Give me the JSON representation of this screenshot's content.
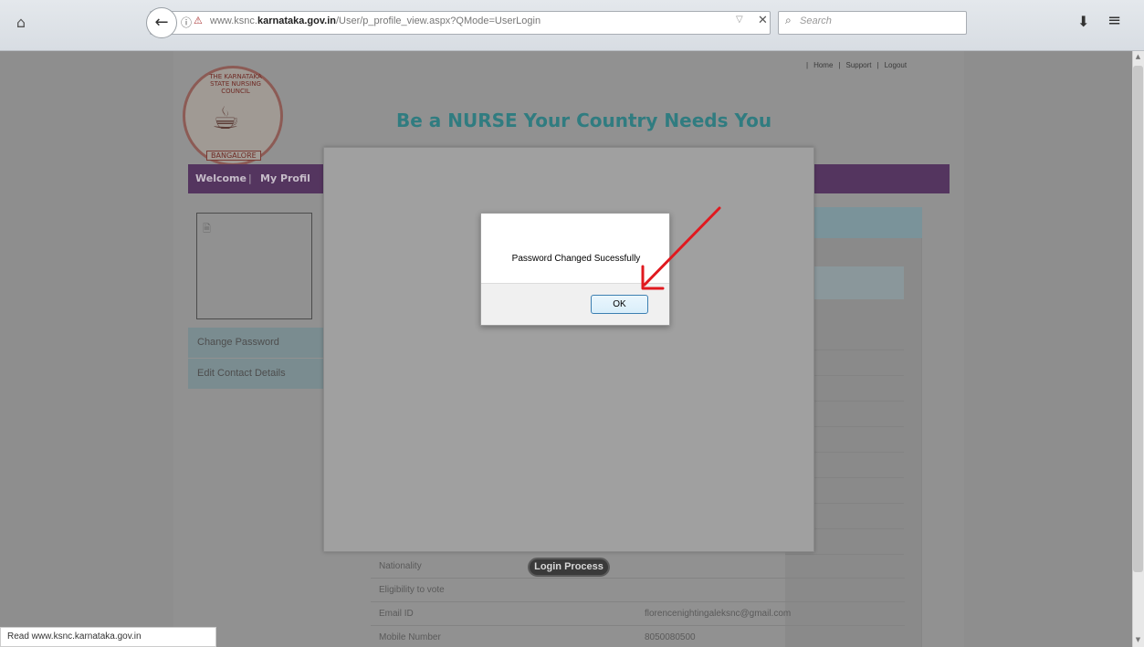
{
  "browser": {
    "url_prefix": "www.ksnc.",
    "url_domain": "karnataka.gov.in",
    "url_path": "/User/p_profile_view.aspx?QMode=UserLogin",
    "search_placeholder": "Search",
    "icons": {
      "home": "home-icon",
      "back": "back-arrow-icon",
      "info": "info-icon",
      "insecure": "insecure-lock-icon",
      "dropdown": "dropdown-icon",
      "clear": "close-icon",
      "search": "search-icon",
      "download": "download-icon",
      "menu": "hamburger-menu-icon"
    }
  },
  "header": {
    "links": [
      "Home",
      "Support",
      "Logout"
    ],
    "tagline": "Be a NURSE Your Country Needs You",
    "logo_text": "THE KARNATAKA STATE NURSING COUNCIL",
    "logo_sub": "BANGALORE"
  },
  "nav": {
    "welcome": "Welcome",
    "separator": "|",
    "my_profile": "My Profil"
  },
  "sidebar": {
    "items": [
      {
        "label": "Change Password"
      },
      {
        "label": "Edit Contact Details"
      }
    ]
  },
  "details": {
    "rows": [
      {
        "label": "Nationality",
        "value": ""
      },
      {
        "label": "Eligibility to vote",
        "value": ""
      },
      {
        "label": "Email ID",
        "value": "florencenightingaleksnc@gmail.com"
      },
      {
        "label": "Mobile Number",
        "value": "8050080500"
      }
    ],
    "login_process": "Login Process"
  },
  "alert": {
    "message": "Password Changed Sucessfully",
    "ok_label": "OK"
  },
  "status_bar": {
    "text": "Read www.ksnc.karnataka.gov.in"
  },
  "colors": {
    "navbar": "#54355f",
    "tagline": "#307c80",
    "annotation_arrow": "#e0191f"
  }
}
